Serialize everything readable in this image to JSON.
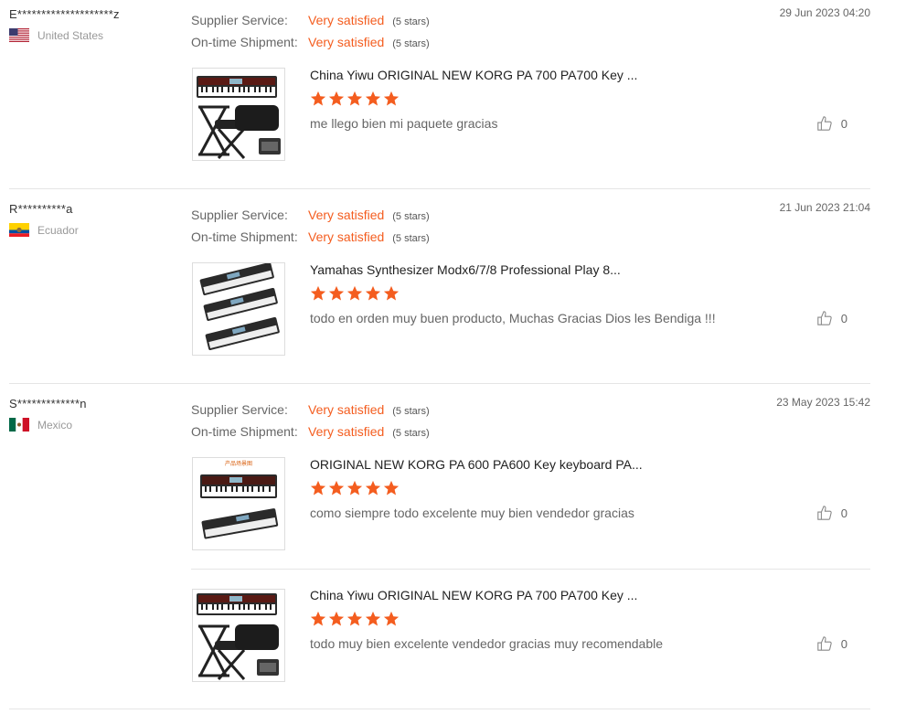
{
  "labels": {
    "supplier_service": "Supplier Service:",
    "ontime_shipment": "On-time Shipment:"
  },
  "colors": {
    "accent": "#f45d1f",
    "divider": "#e5e5e5"
  },
  "reviews": [
    {
      "user": "E********************z",
      "country": "United States",
      "flag_icon": "us-flag-icon",
      "date": "29 Jun 2023 04:20",
      "supplier_service": {
        "value": "Very satisfied",
        "stars": "(5 stars)"
      },
      "ontime_shipment": {
        "value": "Very satisfied",
        "stars": "(5 stars)"
      },
      "items": [
        {
          "title": "China Yiwu ORIGINAL NEW KORG PA 700 PA700 Key ...",
          "rating": 5,
          "comment": "me llego bien mi paquete gracias",
          "likes": "0"
        }
      ]
    },
    {
      "user": "R**********a",
      "country": "Ecuador",
      "flag_icon": "ecuador-flag-icon",
      "date": "21 Jun 2023 21:04",
      "supplier_service": {
        "value": "Very satisfied",
        "stars": "(5 stars)"
      },
      "ontime_shipment": {
        "value": "Very satisfied",
        "stars": "(5 stars)"
      },
      "items": [
        {
          "title": "Yamahas Synthesizer Modx6/7/8 Professional Play 8...",
          "rating": 5,
          "comment": "todo en orden muy buen producto, Muchas Gracias Dios les Bendiga !!!",
          "likes": "0"
        }
      ]
    },
    {
      "user": "S*************n",
      "country": "Mexico",
      "flag_icon": "mexico-flag-icon",
      "date": "23 May 2023 15:42",
      "supplier_service": {
        "value": "Very satisfied",
        "stars": "(5 stars)"
      },
      "ontime_shipment": {
        "value": "Very satisfied",
        "stars": "(5 stars)"
      },
      "items": [
        {
          "title": "ORIGINAL NEW KORG PA 600 PA600 Key keyboard PA...",
          "rating": 5,
          "comment": "como siempre todo excelente muy bien vendedor gracias",
          "likes": "0",
          "thumb_caption": "产品场景图"
        },
        {
          "title": "China Yiwu ORIGINAL NEW KORG PA 700 PA700 Key ...",
          "rating": 5,
          "comment": "todo muy bien excelente vendedor gracias muy recomendable",
          "likes": "0"
        }
      ]
    }
  ]
}
